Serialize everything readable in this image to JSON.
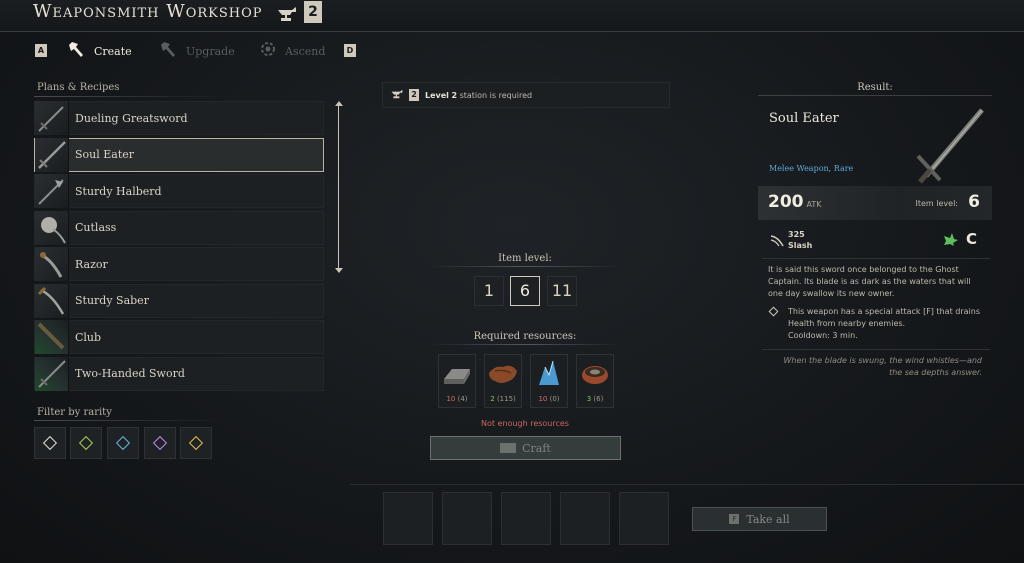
{
  "window": {
    "title": "Weaponsmith Workshop",
    "station_level": "2"
  },
  "tabs": {
    "left_key": "A",
    "right_key": "D",
    "items": [
      {
        "label": "Create",
        "icon": "hammer-icon",
        "active": true
      },
      {
        "label": "Upgrade",
        "icon": "upgrade-hammer-icon",
        "active": false
      },
      {
        "label": "Ascend",
        "icon": "gear-ascend-icon",
        "active": false
      }
    ]
  },
  "recipes": {
    "title": "Plans & Recipes",
    "items": [
      {
        "label": "Dueling Greatsword",
        "rarity": "common"
      },
      {
        "label": "Soul Eater",
        "rarity": "common",
        "selected": true
      },
      {
        "label": "Sturdy Halberd",
        "rarity": "common"
      },
      {
        "label": "Cutlass",
        "rarity": "common"
      },
      {
        "label": "Razor",
        "rarity": "common"
      },
      {
        "label": "Sturdy Saber",
        "rarity": "common"
      },
      {
        "label": "Club",
        "rarity": "uncommon"
      },
      {
        "label": "Two-Handed Sword",
        "rarity": "uncommon"
      }
    ]
  },
  "filter": {
    "title": "Filter by rarity",
    "colors": [
      "#e4e0d4",
      "#a8d05a",
      "#6ab4d8",
      "#c08ae8",
      "#e0c050"
    ]
  },
  "station": {
    "level_label": "Level",
    "level_value": "2",
    "suffix": "station is required",
    "lv_badge": "2"
  },
  "item_level": {
    "title": "Item level:",
    "options": [
      "1",
      "6",
      "11"
    ],
    "selected": "6"
  },
  "resources": {
    "title": "Required resources:",
    "items": [
      {
        "have": "10",
        "need": "(4)",
        "ok": false,
        "icon": "iron-ingot-icon"
      },
      {
        "have": "2",
        "need": "(115)",
        "ok": true,
        "icon": "leather-icon"
      },
      {
        "have": "10",
        "need": "(0)",
        "ok": false,
        "icon": "crystal-icon"
      },
      {
        "have": "3",
        "need": "(6)",
        "ok": true,
        "icon": "powder-bowl-icon"
      }
    ],
    "warning": "Not enough resources"
  },
  "craft": {
    "label": "Craft"
  },
  "take_all": {
    "key": "F",
    "label": "Take all"
  },
  "result": {
    "title": "Result:",
    "name": "Soul Eater",
    "type": "Melee Weapon, Rare",
    "atk": "200",
    "atk_label": "ATK",
    "item_level_label": "Item level:",
    "item_level": "6",
    "damage_value": "325",
    "damage_type": "Slash",
    "grade": "C",
    "description": "It is said this sword once belonged to the Ghost Captain. Its blade is as dark as the waters that will one day swallow its new owner.",
    "special": "This weapon has a special attack [F] that drains Health from nearby enemies.",
    "cooldown": "Cooldown: 3 min.",
    "quote": "When the blade is swung, the wind whistles—and the sea depths answer."
  }
}
